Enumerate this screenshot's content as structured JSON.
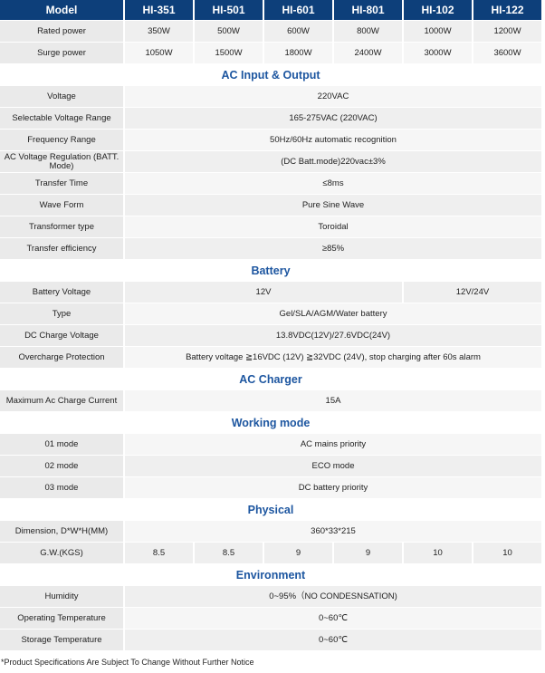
{
  "header": {
    "label": "Model",
    "models": [
      "HI-351",
      "HI-501",
      "HI-601",
      "HI-801",
      "HI-102",
      "HI-122"
    ]
  },
  "sections": [
    {
      "title": "",
      "rows": [
        {
          "label": "Rated power",
          "cells": [
            {
              "text": "350W",
              "span": 1
            },
            {
              "text": "500W",
              "span": 1
            },
            {
              "text": "600W",
              "span": 1
            },
            {
              "text": "800W",
              "span": 1
            },
            {
              "text": "1000W",
              "span": 1
            },
            {
              "text": "1200W",
              "span": 1
            }
          ]
        },
        {
          "label": "Surge power",
          "cells": [
            {
              "text": "1050W",
              "span": 1
            },
            {
              "text": "1500W",
              "span": 1
            },
            {
              "text": "1800W",
              "span": 1
            },
            {
              "text": "2400W",
              "span": 1
            },
            {
              "text": "3000W",
              "span": 1
            },
            {
              "text": "3600W",
              "span": 1
            }
          ]
        }
      ]
    },
    {
      "title": "AC Input & Output",
      "rows": [
        {
          "label": "Voltage",
          "cells": [
            {
              "text": "220VAC",
              "span": 6
            }
          ]
        },
        {
          "label": "Selectable Voltage Range",
          "cells": [
            {
              "text": "165-275VAC (220VAC)",
              "span": 6
            }
          ]
        },
        {
          "label": "Frequency Range",
          "cells": [
            {
              "text": "50Hz/60Hz automatic recognition",
              "span": 6
            }
          ]
        },
        {
          "label": "AC Voltage Regulation (BATT. Mode)",
          "cells": [
            {
              "text": "(DC Batt.mode)220vac±3%",
              "span": 6
            }
          ]
        },
        {
          "label": "Transfer Time",
          "cells": [
            {
              "text": "≤8ms",
              "span": 6
            }
          ]
        },
        {
          "label": "Wave Form",
          "cells": [
            {
              "text": "Pure Sine Wave",
              "span": 6
            }
          ]
        },
        {
          "label": "Transformer type",
          "cells": [
            {
              "text": "Toroidal",
              "span": 6
            }
          ]
        },
        {
          "label": "Transfer efficiency",
          "cells": [
            {
              "text": "≥85%",
              "span": 6
            }
          ]
        }
      ]
    },
    {
      "title": "Battery",
      "rows": [
        {
          "label": "Battery Voltage",
          "cells": [
            {
              "text": "12V",
              "span": 4
            },
            {
              "text": "12V/24V",
              "span": 2
            }
          ]
        },
        {
          "label": "Type",
          "cells": [
            {
              "text": "Gel/SLA/AGM/Water battery",
              "span": 6
            }
          ]
        },
        {
          "label": "DC Charge Voltage",
          "cells": [
            {
              "text": "13.8VDC(12V)/27.6VDC(24V)",
              "span": 6
            }
          ]
        },
        {
          "label": "Overcharge Protection",
          "cells": [
            {
              "text": "Battery voltage ≧16VDC (12V) ≧32VDC (24V), stop charging after 60s alarm",
              "span": 6
            }
          ]
        }
      ]
    },
    {
      "title": "AC Charger",
      "rows": [
        {
          "label": "Maximum Ac Charge Current",
          "cells": [
            {
              "text": "15A",
              "span": 6
            }
          ]
        }
      ]
    },
    {
      "title": "Working mode",
      "rows": [
        {
          "label": "01 mode",
          "cells": [
            {
              "text": "AC mains priority",
              "span": 6
            }
          ]
        },
        {
          "label": "02 mode",
          "cells": [
            {
              "text": "ECO mode",
              "span": 6
            }
          ]
        },
        {
          "label": "03 mode",
          "cells": [
            {
              "text": "DC battery priority",
              "span": 6
            }
          ]
        }
      ]
    },
    {
      "title": "Physical",
      "rows": [
        {
          "label": "Dimension, D*W*H(MM)",
          "cells": [
            {
              "text": "360*33*215",
              "span": 6
            }
          ]
        },
        {
          "label": "G.W.(KGS)",
          "cells": [
            {
              "text": "8.5",
              "span": 1
            },
            {
              "text": "8.5",
              "span": 1
            },
            {
              "text": "9",
              "span": 1
            },
            {
              "text": "9",
              "span": 1
            },
            {
              "text": "10",
              "span": 1
            },
            {
              "text": "10",
              "span": 1
            }
          ]
        }
      ]
    },
    {
      "title": "Environment",
      "rows": [
        {
          "label": "Humidity",
          "cells": [
            {
              "text": "0~95%（NO CONDESNSATION)",
              "span": 6
            }
          ]
        },
        {
          "label": "Operating Temperature",
          "cells": [
            {
              "text": "0~60℃",
              "span": 6
            }
          ]
        },
        {
          "label": "Storage Temperature",
          "cells": [
            {
              "text": "0~60℃",
              "span": 6
            }
          ]
        }
      ]
    }
  ],
  "footnote": "*Product Specifications Are Subject To Change Without Further Notice"
}
